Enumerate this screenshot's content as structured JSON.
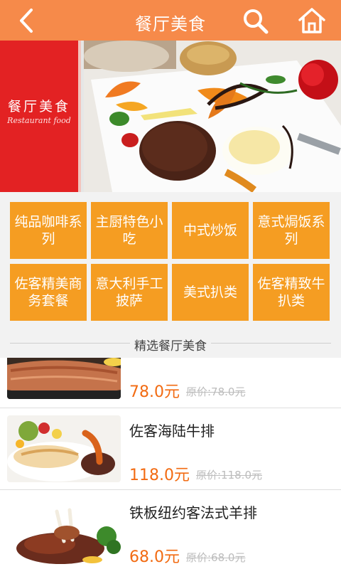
{
  "header": {
    "title": "餐厅美食",
    "icons": [
      "back-arrow-icon",
      "search-icon",
      "home-icon"
    ]
  },
  "banner": {
    "title_cn": "餐厅美食",
    "title_en": "Restaurant food"
  },
  "categories": [
    {
      "label": "纯品咖啡系列"
    },
    {
      "label": "主厨特色小吃"
    },
    {
      "label": "中式炒饭"
    },
    {
      "label": "意式焗饭系列"
    },
    {
      "label": "佐客精美商务套餐"
    },
    {
      "label": "意大利手工披萨"
    },
    {
      "label": "美式扒类"
    },
    {
      "label": "佐客精致牛扒类"
    }
  ],
  "section": {
    "title": "精选餐厅美食"
  },
  "items": [
    {
      "name": "",
      "price": "78.0元",
      "original_price": "原价:78.0元"
    },
    {
      "name": "佐客海陆牛排",
      "price": "118.0元",
      "original_price": "原价:118.0元"
    },
    {
      "name": "铁板纽约客法式羊排",
      "price": "68.0元",
      "original_price": "原价:68.0元"
    }
  ],
  "colors": {
    "header": "#f68a4a",
    "category_tile": "#f59d22",
    "price": "#f26b12",
    "banner_red": "#e32223"
  }
}
